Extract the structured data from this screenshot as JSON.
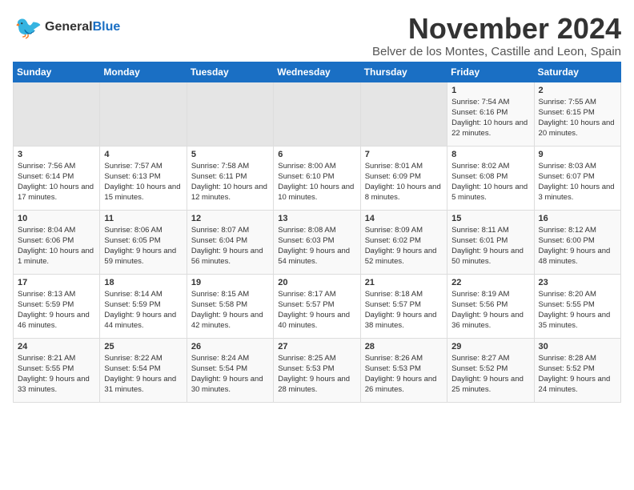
{
  "logo": {
    "line1": "General",
    "line2": "Blue"
  },
  "title": "November 2024",
  "location": "Belver de los Montes, Castille and Leon, Spain",
  "weekdays": [
    "Sunday",
    "Monday",
    "Tuesday",
    "Wednesday",
    "Thursday",
    "Friday",
    "Saturday"
  ],
  "weeks": [
    [
      {
        "day": "",
        "info": ""
      },
      {
        "day": "",
        "info": ""
      },
      {
        "day": "",
        "info": ""
      },
      {
        "day": "",
        "info": ""
      },
      {
        "day": "",
        "info": ""
      },
      {
        "day": "1",
        "info": "Sunrise: 7:54 AM\nSunset: 6:16 PM\nDaylight: 10 hours and 22 minutes."
      },
      {
        "day": "2",
        "info": "Sunrise: 7:55 AM\nSunset: 6:15 PM\nDaylight: 10 hours and 20 minutes."
      }
    ],
    [
      {
        "day": "3",
        "info": "Sunrise: 7:56 AM\nSunset: 6:14 PM\nDaylight: 10 hours and 17 minutes."
      },
      {
        "day": "4",
        "info": "Sunrise: 7:57 AM\nSunset: 6:13 PM\nDaylight: 10 hours and 15 minutes."
      },
      {
        "day": "5",
        "info": "Sunrise: 7:58 AM\nSunset: 6:11 PM\nDaylight: 10 hours and 12 minutes."
      },
      {
        "day": "6",
        "info": "Sunrise: 8:00 AM\nSunset: 6:10 PM\nDaylight: 10 hours and 10 minutes."
      },
      {
        "day": "7",
        "info": "Sunrise: 8:01 AM\nSunset: 6:09 PM\nDaylight: 10 hours and 8 minutes."
      },
      {
        "day": "8",
        "info": "Sunrise: 8:02 AM\nSunset: 6:08 PM\nDaylight: 10 hours and 5 minutes."
      },
      {
        "day": "9",
        "info": "Sunrise: 8:03 AM\nSunset: 6:07 PM\nDaylight: 10 hours and 3 minutes."
      }
    ],
    [
      {
        "day": "10",
        "info": "Sunrise: 8:04 AM\nSunset: 6:06 PM\nDaylight: 10 hours and 1 minute."
      },
      {
        "day": "11",
        "info": "Sunrise: 8:06 AM\nSunset: 6:05 PM\nDaylight: 9 hours and 59 minutes."
      },
      {
        "day": "12",
        "info": "Sunrise: 8:07 AM\nSunset: 6:04 PM\nDaylight: 9 hours and 56 minutes."
      },
      {
        "day": "13",
        "info": "Sunrise: 8:08 AM\nSunset: 6:03 PM\nDaylight: 9 hours and 54 minutes."
      },
      {
        "day": "14",
        "info": "Sunrise: 8:09 AM\nSunset: 6:02 PM\nDaylight: 9 hours and 52 minutes."
      },
      {
        "day": "15",
        "info": "Sunrise: 8:11 AM\nSunset: 6:01 PM\nDaylight: 9 hours and 50 minutes."
      },
      {
        "day": "16",
        "info": "Sunrise: 8:12 AM\nSunset: 6:00 PM\nDaylight: 9 hours and 48 minutes."
      }
    ],
    [
      {
        "day": "17",
        "info": "Sunrise: 8:13 AM\nSunset: 5:59 PM\nDaylight: 9 hours and 46 minutes."
      },
      {
        "day": "18",
        "info": "Sunrise: 8:14 AM\nSunset: 5:59 PM\nDaylight: 9 hours and 44 minutes."
      },
      {
        "day": "19",
        "info": "Sunrise: 8:15 AM\nSunset: 5:58 PM\nDaylight: 9 hours and 42 minutes."
      },
      {
        "day": "20",
        "info": "Sunrise: 8:17 AM\nSunset: 5:57 PM\nDaylight: 9 hours and 40 minutes."
      },
      {
        "day": "21",
        "info": "Sunrise: 8:18 AM\nSunset: 5:57 PM\nDaylight: 9 hours and 38 minutes."
      },
      {
        "day": "22",
        "info": "Sunrise: 8:19 AM\nSunset: 5:56 PM\nDaylight: 9 hours and 36 minutes."
      },
      {
        "day": "23",
        "info": "Sunrise: 8:20 AM\nSunset: 5:55 PM\nDaylight: 9 hours and 35 minutes."
      }
    ],
    [
      {
        "day": "24",
        "info": "Sunrise: 8:21 AM\nSunset: 5:55 PM\nDaylight: 9 hours and 33 minutes."
      },
      {
        "day": "25",
        "info": "Sunrise: 8:22 AM\nSunset: 5:54 PM\nDaylight: 9 hours and 31 minutes."
      },
      {
        "day": "26",
        "info": "Sunrise: 8:24 AM\nSunset: 5:54 PM\nDaylight: 9 hours and 30 minutes."
      },
      {
        "day": "27",
        "info": "Sunrise: 8:25 AM\nSunset: 5:53 PM\nDaylight: 9 hours and 28 minutes."
      },
      {
        "day": "28",
        "info": "Sunrise: 8:26 AM\nSunset: 5:53 PM\nDaylight: 9 hours and 26 minutes."
      },
      {
        "day": "29",
        "info": "Sunrise: 8:27 AM\nSunset: 5:52 PM\nDaylight: 9 hours and 25 minutes."
      },
      {
        "day": "30",
        "info": "Sunrise: 8:28 AM\nSunset: 5:52 PM\nDaylight: 9 hours and 24 minutes."
      }
    ]
  ]
}
